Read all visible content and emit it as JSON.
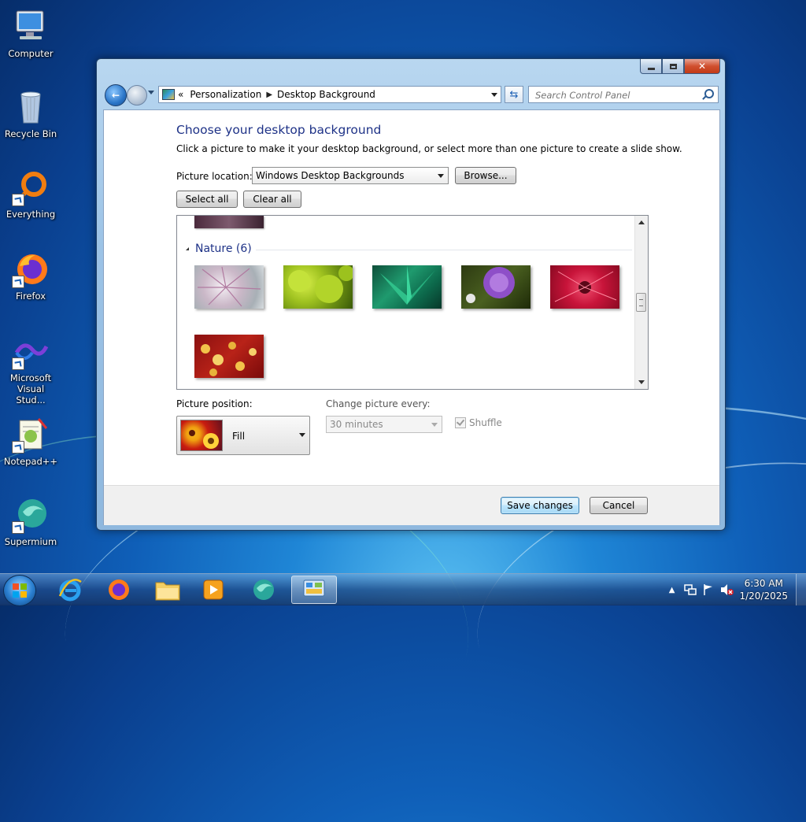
{
  "desktop": {
    "icons": [
      {
        "label": "Computer"
      },
      {
        "label": "Recycle Bin"
      },
      {
        "label": "Everything"
      },
      {
        "label": "Firefox"
      },
      {
        "label": "Microsoft Visual Stud..."
      },
      {
        "label": "Notepad++"
      },
      {
        "label": "Supermium"
      }
    ]
  },
  "window": {
    "breadcrumb": {
      "prefix": "«",
      "items": [
        "Personalization",
        "Desktop Background"
      ]
    },
    "search_placeholder": "Search Control Panel",
    "heading": "Choose your desktop background",
    "subtitle": "Click a picture to make it your desktop background, or select more than one picture to create a slide show.",
    "picture_location_label": "Picture location:",
    "picture_location_value": "Windows Desktop Backgrounds",
    "browse_label": "Browse...",
    "select_all_label": "Select all",
    "clear_all_label": "Clear all",
    "group_title": "Nature (6)",
    "picture_position_label": "Picture position:",
    "picture_position_value": "Fill",
    "change_picture_label": "Change picture every:",
    "change_picture_value": "30 minutes",
    "shuffle_label": "Shuffle",
    "save_label": "Save changes",
    "cancel_label": "Cancel"
  },
  "taskbar": {
    "time": "6:30 AM",
    "date": "1/20/2025"
  },
  "colors": {
    "heading": "#1e3287",
    "accent": "#3c7fb1"
  }
}
